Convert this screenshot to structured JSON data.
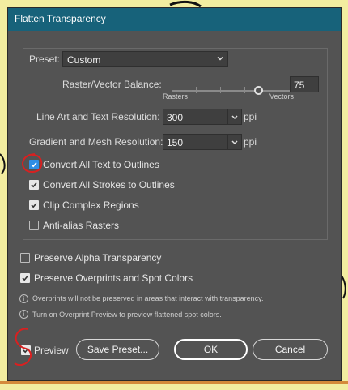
{
  "dialog": {
    "title": "Flatten Transparency"
  },
  "preset": {
    "label": "Preset:",
    "value": "Custom"
  },
  "balance": {
    "label": "Raster/Vector Balance:",
    "value": "75",
    "left_label": "Rasters",
    "right_label": "Vectors",
    "level": 0.75
  },
  "line_art": {
    "label": "Line Art and Text Resolution:",
    "value": "300",
    "unit": "ppi"
  },
  "gradient": {
    "label": "Gradient and Mesh Resolution:",
    "value": "150",
    "unit": "ppi"
  },
  "options": [
    {
      "label": "Convert All Text to Outlines",
      "checked": true
    },
    {
      "label": "Convert All Strokes to Outlines",
      "checked": true
    },
    {
      "label": "Clip Complex Regions",
      "checked": true
    },
    {
      "label": "Anti-alias Rasters",
      "checked": false
    }
  ],
  "preserve": [
    {
      "label": "Preserve Alpha Transparency",
      "checked": false
    },
    {
      "label": "Preserve Overprints and Spot Colors",
      "checked": true
    }
  ],
  "notes": [
    "Overprints will not be preserved in areas that interact with transparency.",
    "Turn on Overprint Preview to preview flattened spot colors."
  ],
  "footer": {
    "preview_label": "Preview",
    "preview_checked": true,
    "save_preset": "Save Preset...",
    "ok": "OK",
    "cancel": "Cancel"
  },
  "colors": {
    "titlebar": "#17627a",
    "dialog_bg": "#535353",
    "accent_check": "#2f8ee6",
    "annotation_red": "#d92020"
  }
}
